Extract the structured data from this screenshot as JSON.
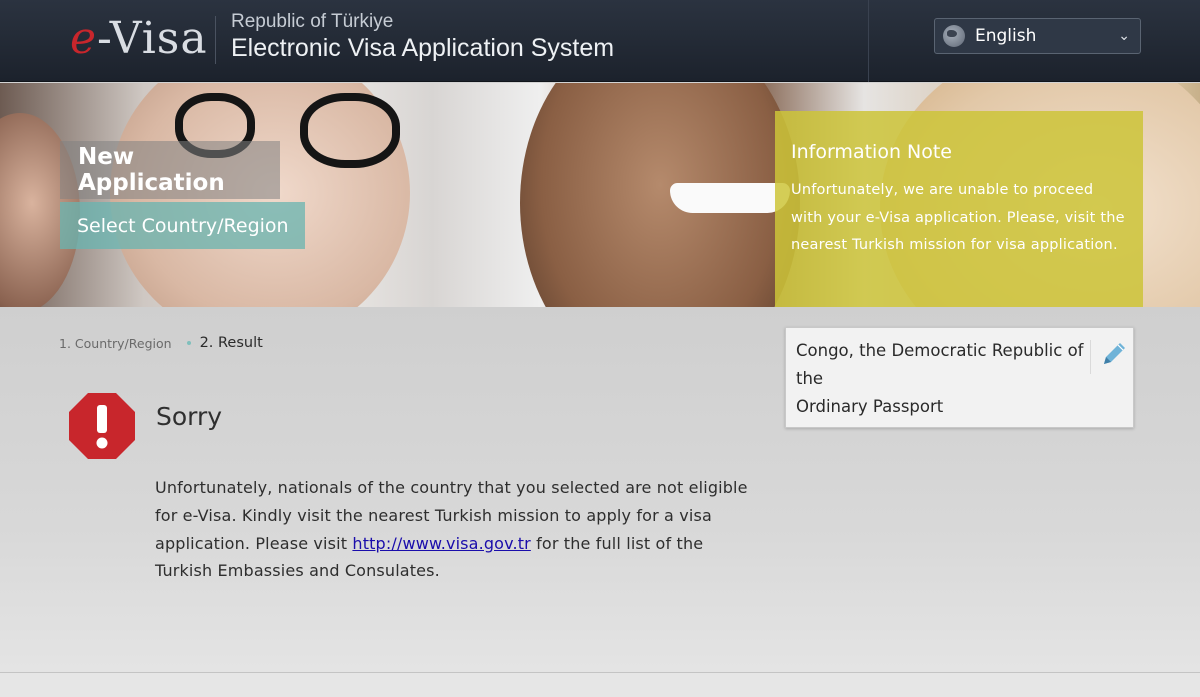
{
  "header": {
    "logo_e": "e",
    "logo_rest": "-Visa",
    "subtitle": "Republic of Türkiye",
    "title": "Electronic Visa Application System",
    "language": {
      "selected": "English",
      "icon": "globe-icon"
    }
  },
  "banner": {
    "new_application": "New Application",
    "select_country": "Select Country/Region",
    "info_note": {
      "title": "Information Note",
      "body": "Unfortunately, we are unable to proceed with your e-Visa application. Please, visit the nearest Turkish mission for visa application."
    }
  },
  "steps": {
    "step1": "1. Country/Region",
    "step2": "2. Result"
  },
  "result": {
    "icon": "stop-alert-icon",
    "title": "Sorry",
    "message_before": "Unfortunately, nationals of the country that you selected are not eligible for e-Visa. Kindly visit the nearest Turkish mission to apply for a visa application. Please visit ",
    "link_text": "http://www.visa.gov.tr",
    "message_after": " for the full list of the Turkish Embassies and Consulates."
  },
  "selection": {
    "country": "Congo, the Democratic Republic of the",
    "document": "Ordinary Passport",
    "edit_icon": "pencil-icon"
  },
  "colors": {
    "header_bg": "#1f2631",
    "info_note_bg": "#ccc438",
    "select_country_bg": "#68b4b0",
    "stop_icon": "#c8262c",
    "link": "#1a0dab"
  }
}
